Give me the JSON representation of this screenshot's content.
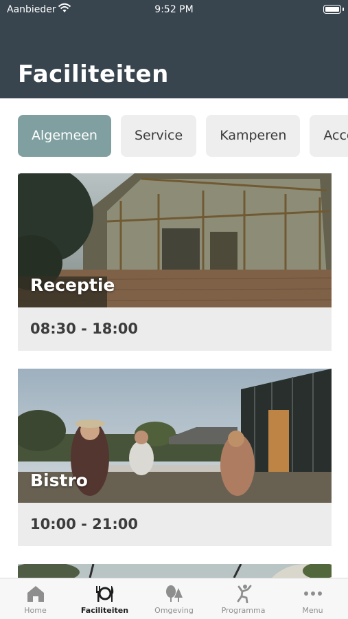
{
  "status_bar": {
    "carrier": "Aanbieder",
    "time": "9:52 PM"
  },
  "header": {
    "title": "Faciliteiten"
  },
  "tabs": [
    {
      "label": "Algemeen",
      "active": true
    },
    {
      "label": "Service",
      "active": false
    },
    {
      "label": "Kamperen",
      "active": false
    },
    {
      "label": "Accommodaties",
      "active": false
    }
  ],
  "facilities": [
    {
      "name": "Receptie",
      "hours": "08:30 - 18:00"
    },
    {
      "name": "Bistro",
      "hours": "10:00 - 21:00"
    }
  ],
  "tab_bar": {
    "items": [
      {
        "label": "Home",
        "icon": "house-icon"
      },
      {
        "label": "Faciliteiten",
        "icon": "cutlery-icon",
        "active": true
      },
      {
        "label": "Omgeving",
        "icon": "trees-icon"
      },
      {
        "label": "Programma",
        "icon": "person-jumping-icon"
      },
      {
        "label": "Menu",
        "icon": "more-dots-icon"
      }
    ]
  },
  "colors": {
    "header": "#38454f",
    "active_tab": "#7f9fa0",
    "card_bg": "#ececec"
  }
}
